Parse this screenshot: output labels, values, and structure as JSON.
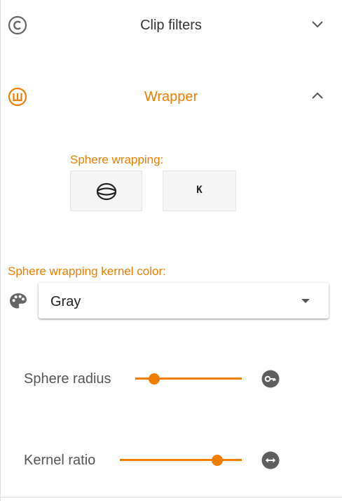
{
  "colors": {
    "accent": "#ee7d00",
    "text": "#333333",
    "muted": "#555555",
    "toggle_bg": "#f5f5f5"
  },
  "panels": {
    "clip_filters": {
      "title": "Clip filters",
      "icon": "c-circle-icon",
      "expanded": false
    },
    "wrapper": {
      "title": "Wrapper",
      "icon": "w-circle-icon",
      "expanded": true
    }
  },
  "wrapper": {
    "sphere_wrapping": {
      "label": "Sphere wrapping:",
      "options": [
        {
          "icon": "sphere-icon"
        },
        {
          "glyph": "K"
        }
      ]
    },
    "kernel_color": {
      "label": "Sphere wrapping kernel color:",
      "icon": "palette-icon",
      "selected": "Gray"
    },
    "sphere_radius": {
      "label": "Sphere radius",
      "value_fraction": 0.18,
      "icon": "key-circle-icon"
    },
    "kernel_ratio": {
      "label": "Kernel ratio",
      "value_fraction": 0.8,
      "icon": "horizontal-arrows-circle-icon"
    }
  }
}
